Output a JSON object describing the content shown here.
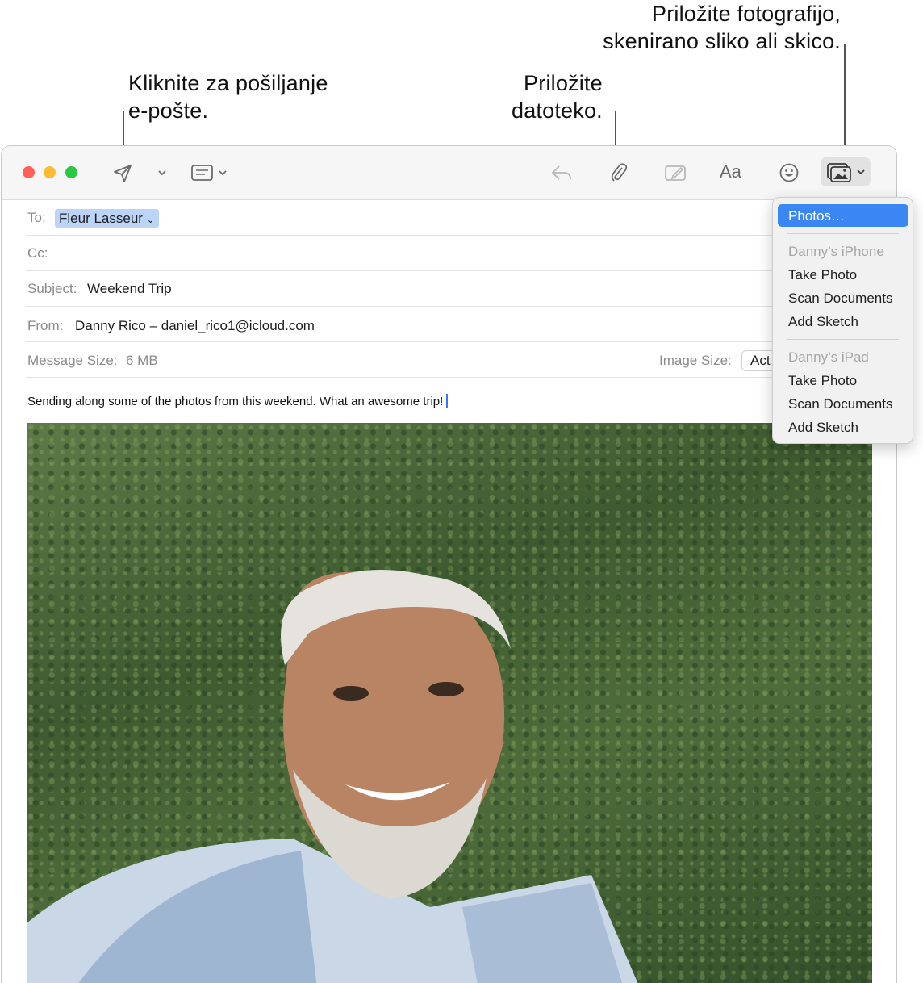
{
  "callouts": {
    "send": [
      "Kliknite za pošiljanje",
      "e-pošte."
    ],
    "attach_file": [
      "Priložite",
      "datoteko."
    ],
    "attach_photo": [
      "Priložite fotografijo,",
      "skenirano sliko ali skico."
    ]
  },
  "toolbar": {
    "text_format_label": "Aa",
    "icons": [
      "send-icon",
      "chevron-down-icon",
      "header-fields-icon",
      "reply-icon",
      "paperclip-icon",
      "markup-icon",
      "text-format-icon",
      "emoji-icon",
      "photo-browser-icon"
    ],
    "traffic_light_colors": [
      "#ff5f57",
      "#febc2e",
      "#28c840"
    ]
  },
  "header": {
    "to_label": "To:",
    "to_recipient": "Fleur Lasseur",
    "cc_label": "Cc:",
    "subject_label": "Subject:",
    "subject_value": "Weekend Trip",
    "from_label": "From:",
    "from_value": "Danny Rico – daniel_rico1@icloud.com",
    "message_size_label": "Message Size:",
    "message_size_value": "6 MB",
    "image_size_label": "Image Size:",
    "image_size_value": "Act"
  },
  "body": {
    "text": "Sending along some of the photos from this weekend. What an awesome trip!"
  },
  "photo_menu": {
    "items": [
      {
        "label": "Photos…",
        "enabled": true,
        "selected": true
      },
      {
        "label": "Danny’s iPhone",
        "enabled": false
      },
      {
        "label": "Take Photo",
        "enabled": true
      },
      {
        "label": "Scan Documents",
        "enabled": true
      },
      {
        "label": "Add Sketch",
        "enabled": true
      },
      {
        "label": "Danny’s iPad",
        "enabled": false
      },
      {
        "label": "Take Photo",
        "enabled": true
      },
      {
        "label": "Scan Documents",
        "enabled": true
      },
      {
        "label": "Add Sketch",
        "enabled": true
      }
    ],
    "highlight_color": "#3a86f3"
  }
}
